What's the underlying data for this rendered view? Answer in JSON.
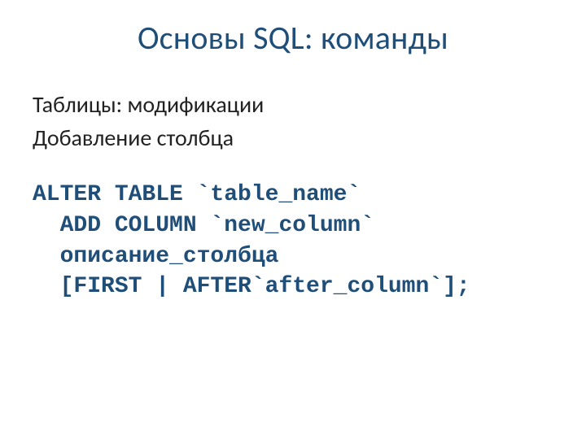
{
  "title": "Основы SQL: команды",
  "body": {
    "line1": "Таблицы: модификации",
    "line2": "Добавление столбца"
  },
  "code": {
    "l1": "ALTER TABLE `table_name`",
    "l2": "  ADD COLUMN `new_column`",
    "l3": "  описание_столбца",
    "l4": "  [FIRST | AFTER`after_column`];"
  }
}
